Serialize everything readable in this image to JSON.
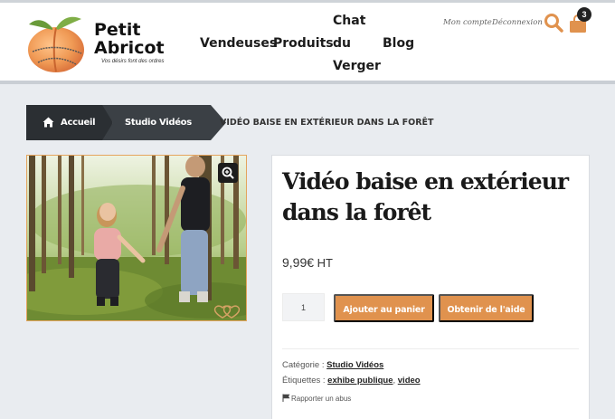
{
  "site": {
    "logo_line1": "Petit",
    "logo_line2": "Abricot",
    "tagline": "Vos désirs font des ordres"
  },
  "nav": {
    "items": [
      {
        "label": "Vendeuses"
      },
      {
        "label": "Produits"
      },
      {
        "label": "Chat du Verger"
      },
      {
        "label": "Blog"
      }
    ]
  },
  "account": {
    "my_account": "Mon compte",
    "logout": "Déconnexion"
  },
  "cart": {
    "count": "3"
  },
  "breadcrumb": {
    "home": "Accueil",
    "category": "Studio Vidéos",
    "current": "VIDÉO BAISE EN EXTÉRIEUR DANS LA FORÊT"
  },
  "product": {
    "title": "Vidéo baise en extérieur dans la forêt",
    "price": "9,99€",
    "price_suffix": "HT",
    "quantity": "1",
    "add_to_cart": "Ajouter au panier",
    "get_help": "Obtenir de l'aide",
    "category_label": "Catégorie :",
    "category_value": "Studio Vidéos",
    "tags_label": "Étiquettes :",
    "tags": [
      "exhibe publique",
      "video"
    ],
    "tags_separator": ", ",
    "report": "Rapporter un abus"
  },
  "colors": {
    "accent": "#e0924e",
    "breadcrumb_dark": "#2b2f33",
    "background": "#e9ecf0"
  },
  "icons": [
    "home-icon",
    "search-icon",
    "shopping-bag-icon",
    "zoom-icon",
    "flag-icon"
  ]
}
